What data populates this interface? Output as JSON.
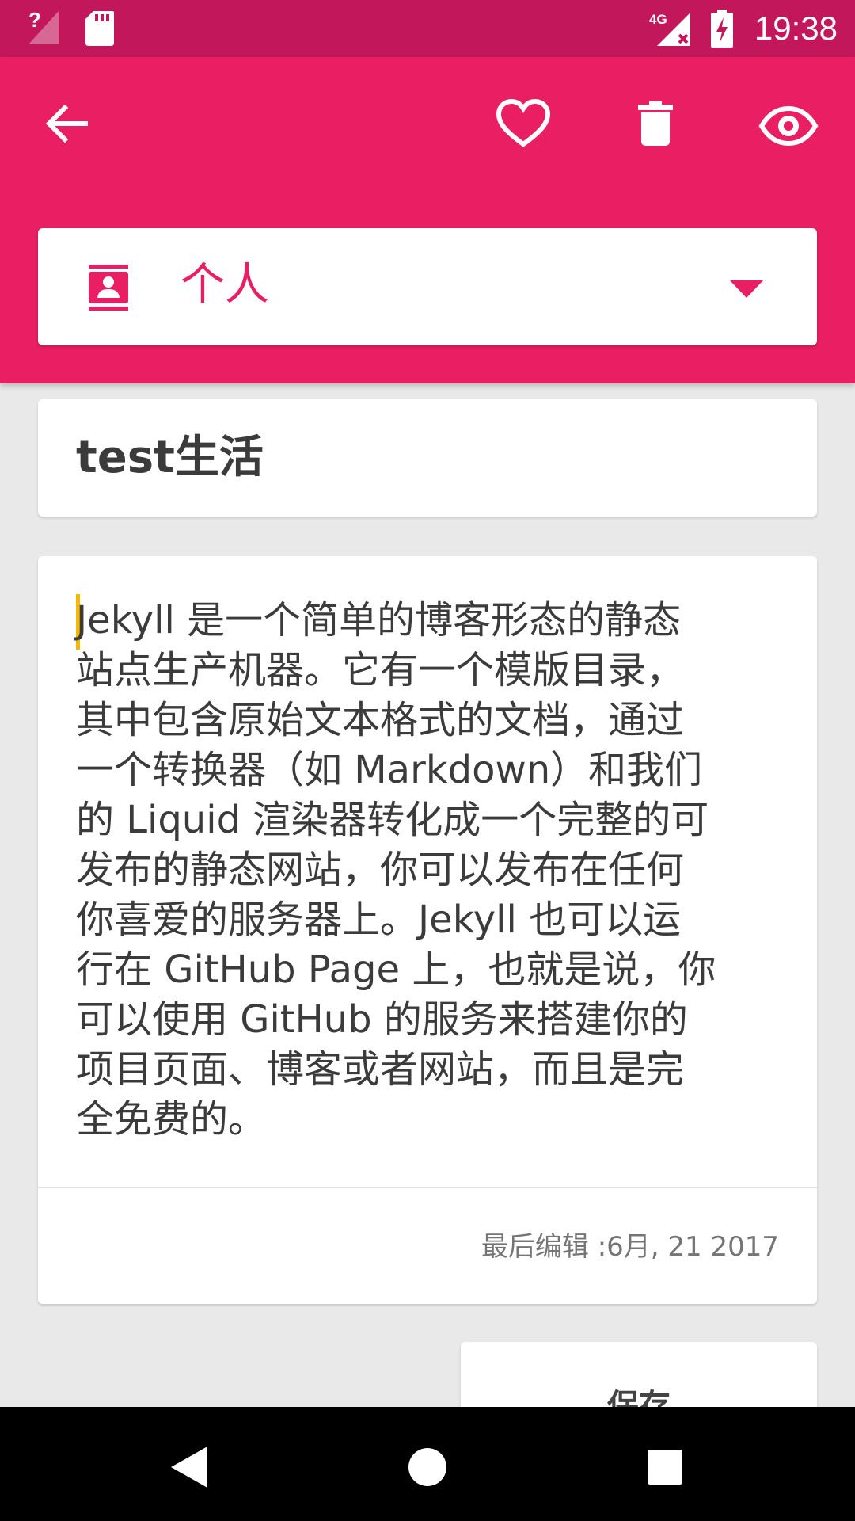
{
  "status_bar": {
    "time": "19:38",
    "icons": [
      "signal-unknown-icon",
      "sd-card-icon",
      "4g-no-signal-icon",
      "battery-charging-icon"
    ],
    "network_label": "4G"
  },
  "toolbar": {
    "background": "#e91e63",
    "icons": [
      "back-arrow-icon",
      "heart-outline-icon",
      "trash-icon",
      "eye-icon"
    ]
  },
  "category": {
    "label": "个人",
    "icon": "contact-card-icon"
  },
  "note": {
    "title": "test生活",
    "body": "Jekyll 是一个简单的博客形态的静态\n站点生产机器。它有一个模版目录，\n其中包含原始文本格式的文档，通过\n一个转换器（如 Markdown）和我们\n的 Liquid 渲染器转化成一个完整的可\n发布的静态网站，你可以发布在任何\n你喜爱的服务器上。Jekyll 也可以运\n行在 GitHub Page 上，也就是说，你\n可以使用 GitHub 的服务来搭建你的\n项目页面、博客或者网站，而且是完\n全免费的。",
    "last_edited": "最后编辑 :6月, 21 2017"
  },
  "actions": {
    "save_label": "保存"
  },
  "colors": {
    "accent": "#e91e63",
    "status_bar": "#c2185b",
    "cursor": "#f5b800"
  }
}
